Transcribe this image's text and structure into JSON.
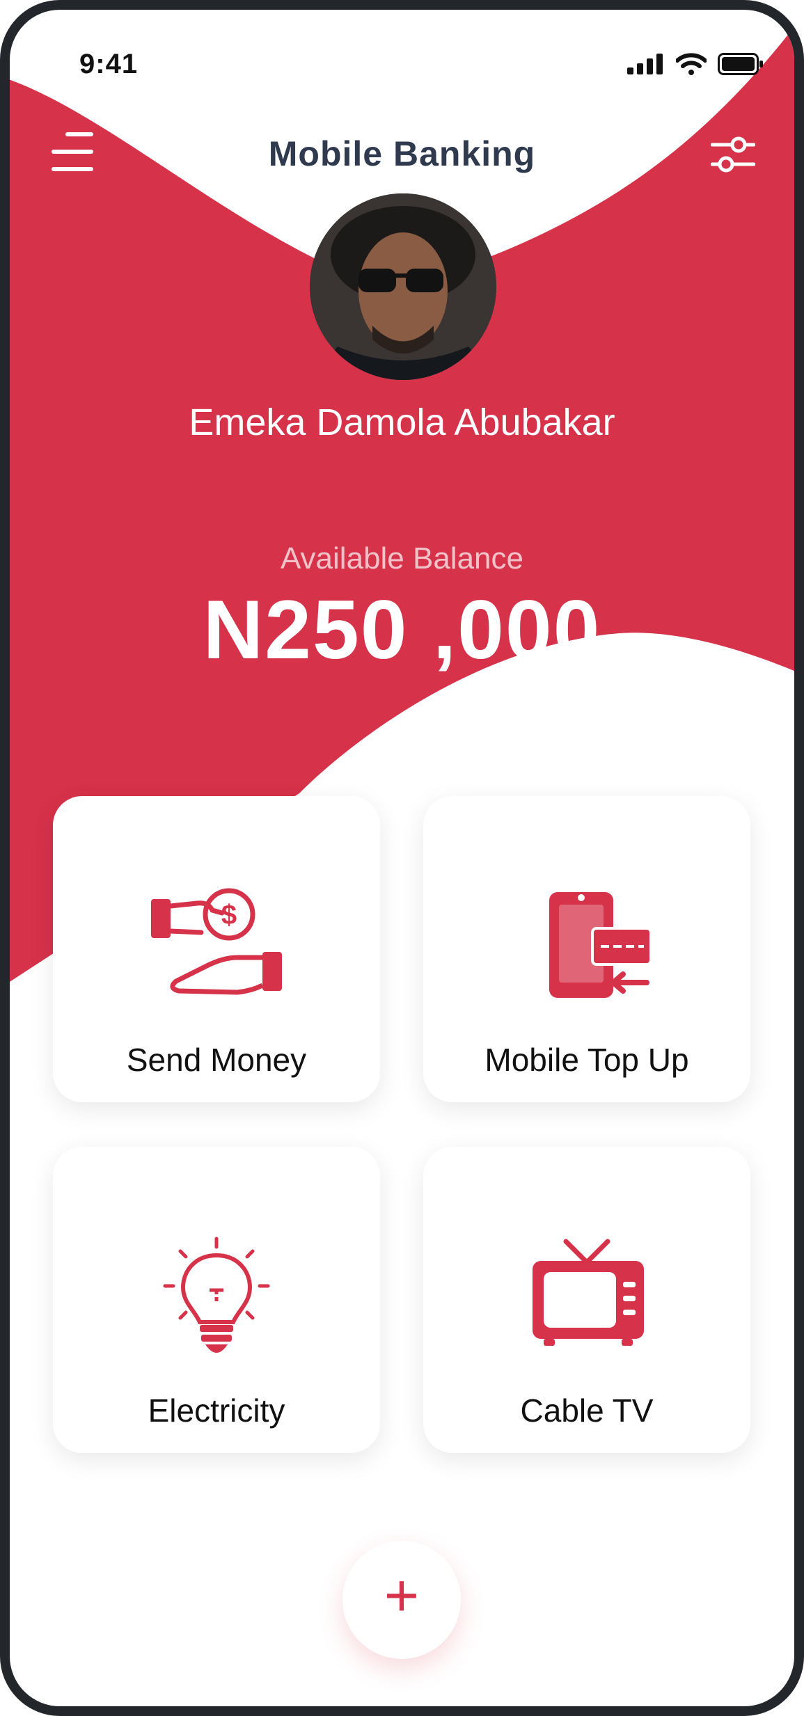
{
  "status_bar": {
    "time": "9:41"
  },
  "header": {
    "title": "Mobile Banking"
  },
  "profile": {
    "name": "Emeka Damola Abubakar"
  },
  "balance": {
    "label": "Available Balance",
    "amount": "N250 ,000"
  },
  "services": [
    {
      "label": "Send Money",
      "icon": "send-money-icon"
    },
    {
      "label": "Mobile Top Up",
      "icon": "mobile-top-up-icon"
    },
    {
      "label": "Electricity",
      "icon": "light-bulb-icon"
    },
    {
      "label": "Cable TV",
      "icon": "tv-icon"
    }
  ],
  "fab": {
    "symbol": "+"
  },
  "colors": {
    "accent": "#d6324a",
    "title": "#2f3a4f",
    "frame": "#23262b"
  }
}
